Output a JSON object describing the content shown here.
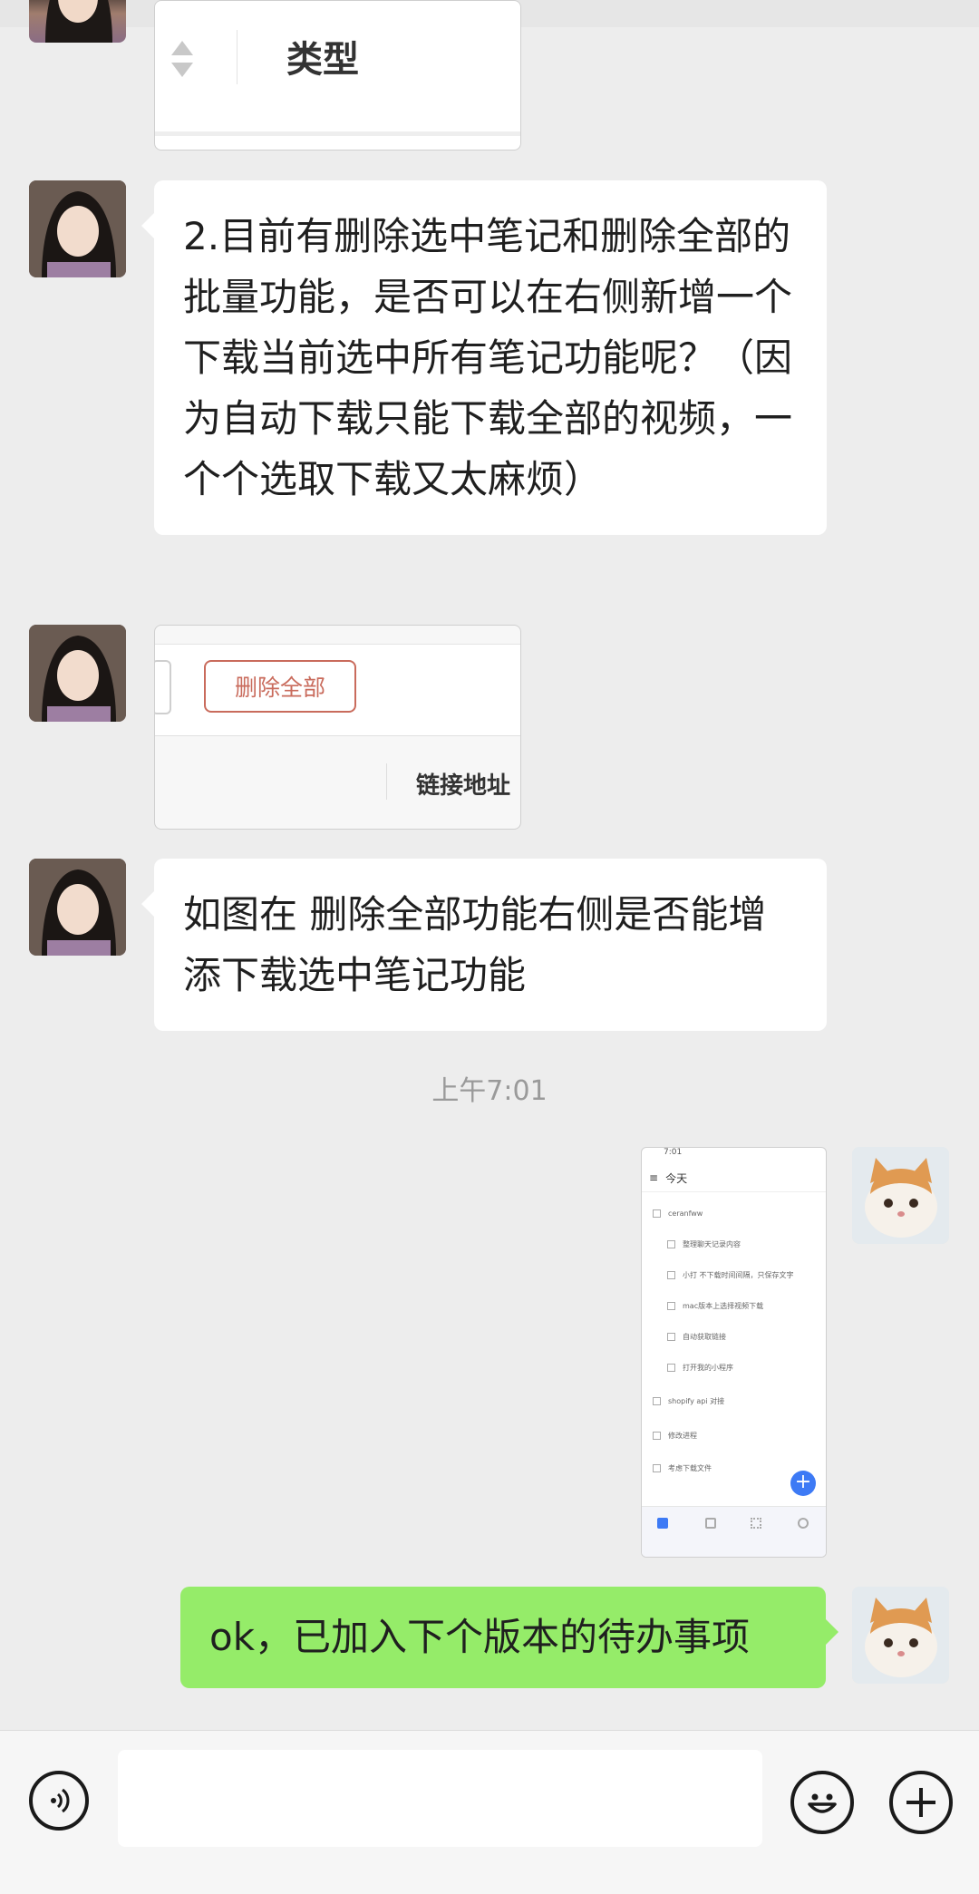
{
  "image1": {
    "sort_label": "类型"
  },
  "msg1": {
    "text": "2.目前有删除选中笔记和删除全部的批量功能，是否可以在右侧新增一个下载当前选中所有笔记功能呢？（因为自动下载只能下载全部的视频，一个个选取下载又太麻烦）"
  },
  "image2": {
    "delete_all_button": "删除全部",
    "column_header": "链接地址"
  },
  "msg2": {
    "text": "如图在 删除全部功能右侧是否能增添下载选中笔记功能"
  },
  "timestamp": "上午7:01",
  "screenshot": {
    "title": "今天",
    "time": "7:01",
    "items": [
      "ceranfww",
      "整理聊天记录内容",
      "小打 不下载时间间隔，只保存文字",
      "mac版本上选择视频下载",
      "自动获取链接",
      "打开我的小程序",
      "shopify api 对接",
      "修改进程",
      "考虑下载文件"
    ]
  },
  "msg3": {
    "text": "ok，已加入下个版本的待办事项"
  },
  "toolbar": {
    "voice_icon": "voice-icon",
    "emoji_icon": "emoji-icon",
    "plus_icon": "plus-icon"
  }
}
